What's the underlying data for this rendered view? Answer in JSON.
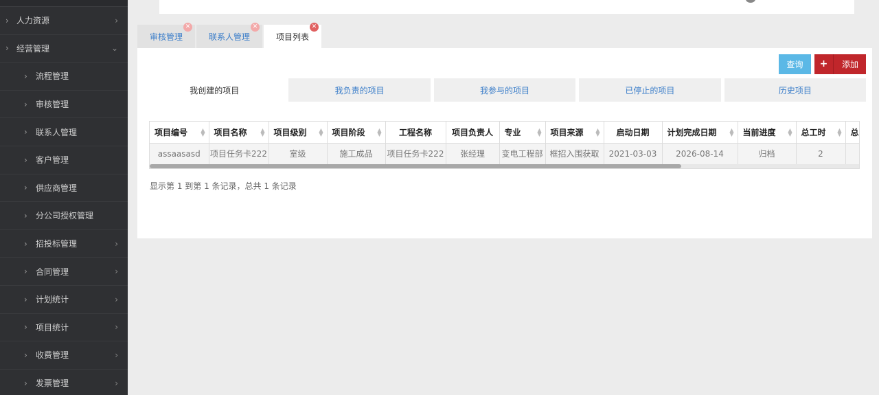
{
  "sidebar": {
    "items": [
      {
        "label": "人力资源",
        "level": 1,
        "expanded": false
      },
      {
        "label": "经营管理",
        "level": 1,
        "expanded": true
      },
      {
        "label": "流程管理",
        "level": 2,
        "hasChildren": false
      },
      {
        "label": "审核管理",
        "level": 2,
        "hasChildren": false
      },
      {
        "label": "联系人管理",
        "level": 2,
        "hasChildren": false
      },
      {
        "label": "客户管理",
        "level": 2,
        "hasChildren": false
      },
      {
        "label": "供应商管理",
        "level": 2,
        "hasChildren": false
      },
      {
        "label": "分公司授权管理",
        "level": 2,
        "hasChildren": false
      },
      {
        "label": "招投标管理",
        "level": 2,
        "hasChildren": true
      },
      {
        "label": "合同管理",
        "level": 2,
        "hasChildren": true
      },
      {
        "label": "计划统计",
        "level": 2,
        "hasChildren": true
      },
      {
        "label": "项目统计",
        "level": 2,
        "hasChildren": true
      },
      {
        "label": "收费管理",
        "level": 2,
        "hasChildren": true
      },
      {
        "label": "发票管理",
        "level": 2,
        "hasChildren": true
      }
    ]
  },
  "tabs": [
    {
      "label": "审核管理",
      "active": false
    },
    {
      "label": "联系人管理",
      "active": false
    },
    {
      "label": "项目列表",
      "active": true
    }
  ],
  "toolbar": {
    "query_label": "查询",
    "add_label": "添加"
  },
  "subtabs": [
    {
      "label": "我创建的项目",
      "active": true
    },
    {
      "label": "我负责的项目",
      "active": false
    },
    {
      "label": "我参与的项目",
      "active": false
    },
    {
      "label": "已停止的项目",
      "active": false
    },
    {
      "label": "历史项目",
      "active": false
    }
  ],
  "table": {
    "columns": [
      "项目编号",
      "项目名称",
      "项目级别",
      "项目阶段",
      "工程名称",
      "项目负责人",
      "专业",
      "项目来源",
      "启动日期",
      "计划完成日期",
      "当前进度",
      "总工时",
      "总"
    ],
    "rows": [
      [
        "assaasasd",
        "项目任务卡222",
        "室级",
        "施工成品",
        "项目任务卡222",
        "张经理",
        "变电工程部",
        "框招入围获取",
        "2021-03-03",
        "2026-08-14",
        "归档",
        "2",
        ""
      ]
    ]
  },
  "pager": {
    "text": "显示第 1 到第 1 条记录，总共 1 条记录"
  }
}
